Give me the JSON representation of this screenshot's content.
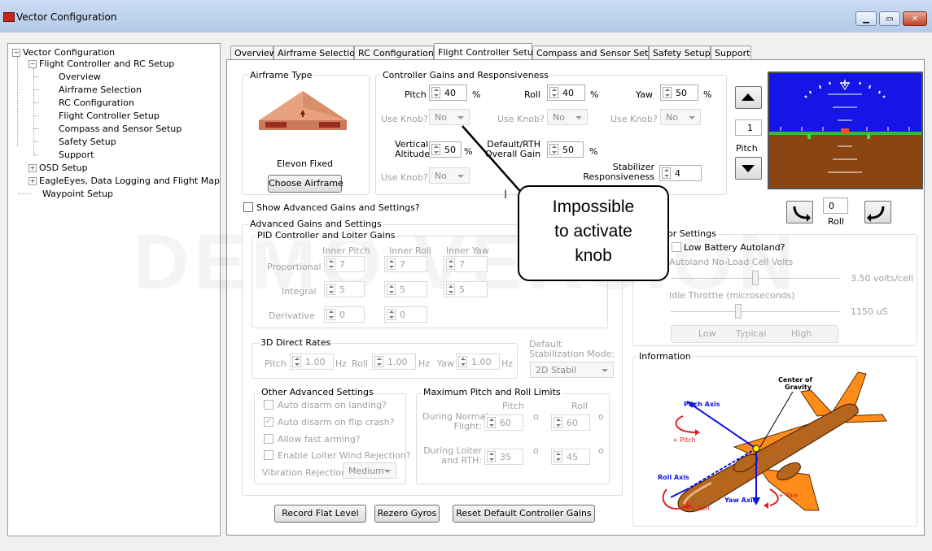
{
  "window": {
    "title": "Vector Configuration",
    "btn_min": "▁",
    "btn_max": "▭",
    "btn_close": "✕",
    "watermark": "DEMO VERSION"
  },
  "tree": {
    "root": "Vector Configuration",
    "group1": "Flight Controller and RC Setup",
    "items": [
      "Overview",
      "Airframe Selection",
      "RC Configuration",
      "Flight Controller Setup",
      "Compass and Sensor Setup",
      "Safety Setup",
      "Support"
    ],
    "osd": "OSD Setup",
    "eagle": "EagleEyes, Data Logging and Flight Map",
    "waypoint": "Waypoint Setup",
    "collapse": "−",
    "expand": "+"
  },
  "tabs": [
    "Overview",
    "Airframe Selection",
    "RC Configuration",
    "Flight Controller Setup",
    "Compass and Sensor Setup",
    "Safety Setup",
    "Support"
  ],
  "airframe": {
    "group": "Airframe Type",
    "name": "Elevon Fixed",
    "button": "Choose Airframe"
  },
  "gains": {
    "group": "Controller Gains and Responsiveness",
    "pitch_label": "Pitch",
    "pitch": "40",
    "roll_label": "Roll",
    "roll": "40",
    "yaw_label": "Yaw",
    "yaw": "50",
    "pct": "%",
    "use_knob": "Use Knob?",
    "no": "No",
    "vert_label_1": "Vertical",
    "vert_label_2": "Altitude",
    "vert": "50",
    "rth_label_1": "Default/RTH",
    "rth_label_2": "Overall Gain",
    "rth": "50",
    "stab_label_1": "Stabilizer",
    "stab_label_2": "Responsiveness",
    "stab": "4"
  },
  "attitude": {
    "pitch_val": "1",
    "pitch_label": "Pitch",
    "roll_val": "0",
    "roll_label": "Roll"
  },
  "advanced": {
    "show_label": "Show Advanced Gains and Settings?",
    "group": "Advanced Gains and Settings",
    "pid_group": "PID Controller and Loiter Gains",
    "cols": [
      "Inner Pitch",
      "Inner Roll",
      "Inner Yaw"
    ],
    "rows": [
      "Proportional",
      "Integral",
      "Derivative"
    ],
    "prop": [
      "7",
      "7",
      "7"
    ],
    "integ": [
      "5",
      "5",
      "5"
    ],
    "deriv": [
      "0",
      "0"
    ]
  },
  "rates": {
    "group": "3D Direct Rates",
    "pitch_label": "Pitch",
    "pitch": "1.00",
    "roll_label": "Roll",
    "roll": "1.00",
    "yaw_label": "Yaw",
    "yaw": "1.00",
    "hz": "Hz",
    "mode_label_1": "Default",
    "mode_label_2": "Stabilization Mode:",
    "mode": "2D Stabil"
  },
  "other": {
    "group": "Other Advanced Settings",
    "opts": [
      "Auto disarm on landing?",
      "Auto disarm on flip crash?",
      "Allow fast arming?",
      "Enable Loiter Wind Rejection?"
    ],
    "vib_label": "Vibration Rejection:",
    "vib": "Medium",
    "check": "✓"
  },
  "limits": {
    "group": "Maximum Pitch and Roll Limits",
    "pitch_col": "Pitch",
    "roll_col": "Roll",
    "normal_1": "During Normal",
    "normal_2": "Flight:",
    "loiter_1": "During Loiter",
    "loiter_2": "and RTH:",
    "normal_pitch": "60",
    "normal_roll": "60",
    "loiter_pitch": "35",
    "loiter_roll": "45",
    "deg": "o"
  },
  "motor": {
    "group": "or Settings",
    "low_batt": "Low Battery Autoland?",
    "noload_label": "Autoland No-Load Cell Volts",
    "noload_val": "3.50 volts/cell",
    "idle_label": "Idle Throttle (microseconds)",
    "idle_val": "1150 uS",
    "low": "Low",
    "typical": "Typical",
    "high": "High"
  },
  "info": {
    "group": "Information",
    "cg_1": "Center of",
    "cg_2": "Gravity",
    "pitch_axis": "Pitch Axis",
    "pitch_dir": "+ Pitch",
    "roll_axis": "Roll Axis",
    "roll_dir": "+ Roll",
    "yaw_axis": "Yaw Axis",
    "yaw_dir": "+ Yaw"
  },
  "bottom": {
    "record": "Record Flat Level",
    "rezero": "Rezero Gyros",
    "reset": "Reset Default Controller Gains"
  },
  "callout": {
    "line1": "Impossible",
    "line2": "to activate",
    "line3": "knob"
  }
}
